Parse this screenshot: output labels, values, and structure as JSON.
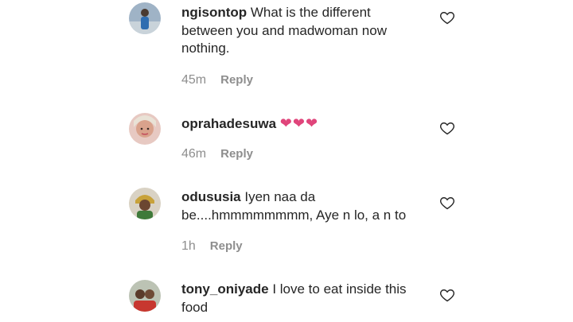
{
  "comments": [
    {
      "username": "ngisontop",
      "text": "What is the different between you and madwoman now nothing.",
      "time": "45m",
      "reply_label": "Reply"
    },
    {
      "username": "oprahadesuwa",
      "text": "",
      "emoji": "❤❤❤",
      "time": "46m",
      "reply_label": "Reply"
    },
    {
      "username": "odususia",
      "text": "Iyen naa da be....hmmmmmmmm, Aye n lo, a n to",
      "time": "1h",
      "reply_label": "Reply"
    },
    {
      "username": "tony_oniyade",
      "text": "I love to eat inside this food",
      "time": "",
      "reply_label": ""
    }
  ],
  "colors": {
    "text": "#262626",
    "meta": "#8e8e8e",
    "heart_emoji": "#e0457b"
  },
  "icons": {
    "like": "heart-outline-icon"
  }
}
